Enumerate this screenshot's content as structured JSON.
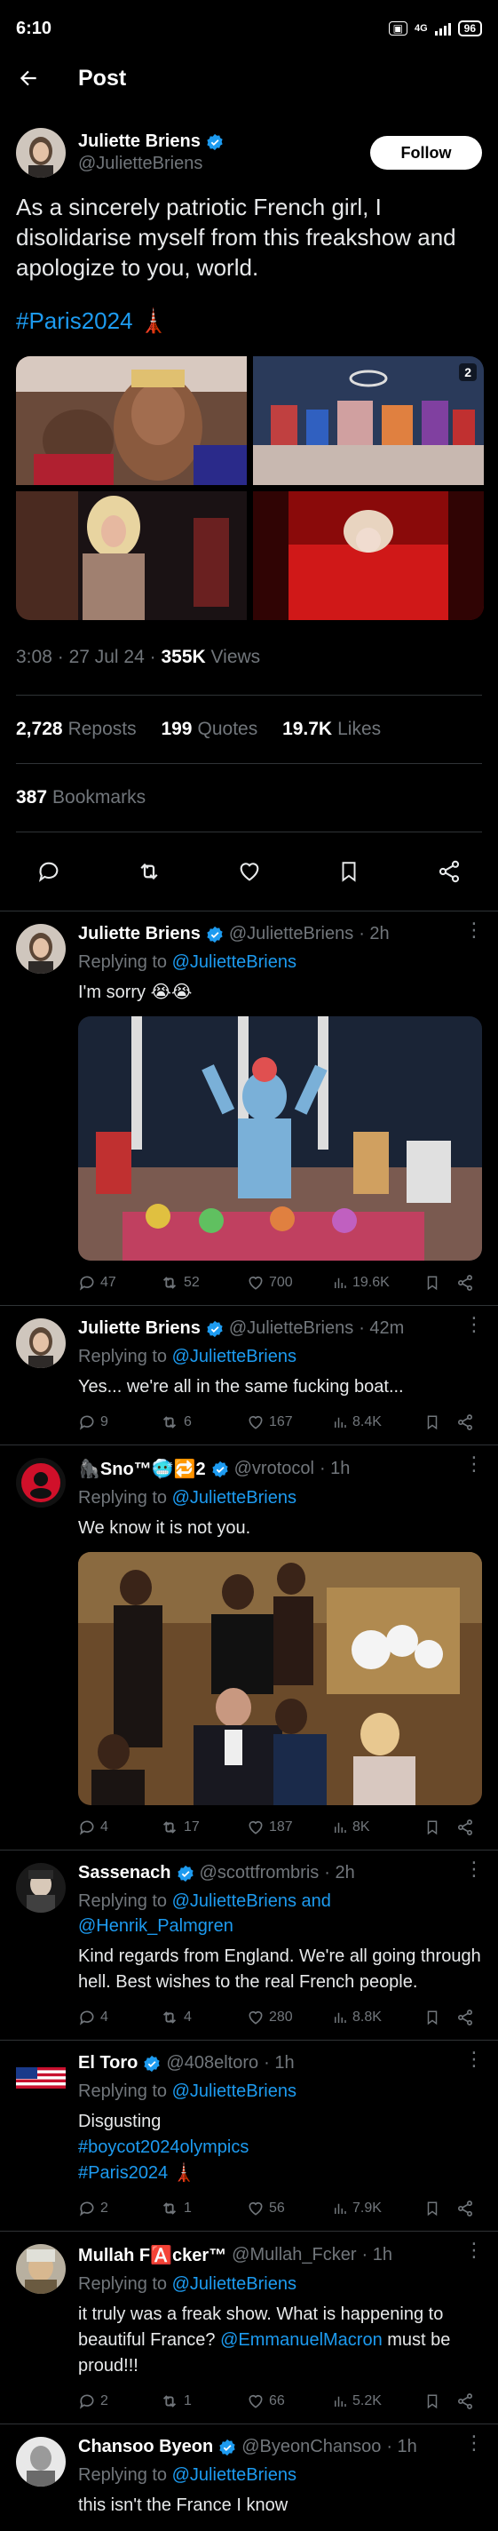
{
  "status_bar": {
    "time": "6:10",
    "volte": "4G",
    "battery": "96"
  },
  "header": {
    "title": "Post"
  },
  "tweet": {
    "author_name": "Juliette Briens",
    "author_handle": "@JulietteBriens",
    "follow_label": "Follow",
    "text": "As a sincerely patriotic French girl, I disolidarise myself from this freakshow and apologize to you, world.",
    "hashtag": "#Paris2024",
    "hashtag_emoji": "🗼",
    "media_badge": "2",
    "time": "3:08",
    "date": "27 Jul 24",
    "views": "355K",
    "views_label": "Views",
    "reposts": "2,728",
    "reposts_label": "Reposts",
    "quotes": "199",
    "quotes_label": "Quotes",
    "likes": "19.7K",
    "likes_label": "Likes",
    "bookmarks": "387",
    "bookmarks_label": "Bookmarks",
    "separator": "·"
  },
  "replies": [
    {
      "name": "Juliette Briens",
      "handle": "@JulietteBriens",
      "time": "· 2h",
      "replying_prefix": "Replying to ",
      "replying_to": "@JulietteBriens",
      "text": "I'm sorry 😭😭",
      "replies": "47",
      "reposts": "52",
      "likes": "700",
      "views": "19.6K"
    },
    {
      "name": "Juliette Briens",
      "handle": "@JulietteBriens",
      "time": "· 42m",
      "replying_prefix": "Replying to ",
      "replying_to": "@JulietteBriens",
      "text": "Yes... we're all in the same fucking boat...",
      "replies": "9",
      "reposts": "6",
      "likes": "167",
      "views": "8.4K"
    },
    {
      "name": "🦍Sno™🥶🔁2",
      "handle": "@vrotocol",
      "time": "· 1h",
      "replying_prefix": "Replying to ",
      "replying_to": "@JulietteBriens",
      "text": "We know it is not you.",
      "replies": "4",
      "reposts": "17",
      "likes": "187",
      "views": "8K"
    },
    {
      "name": "Sassenach",
      "handle": "@scottfrombris",
      "time": "· 2h",
      "replying_prefix": "Replying to ",
      "replying_to": "@JulietteBriens and @Henrik_Palmgren",
      "text": "Kind regards from England. We're all going through hell. Best wishes to the real French people.",
      "replies": "4",
      "reposts": "4",
      "likes": "280",
      "views": "8.8K"
    },
    {
      "name": "El Toro",
      "handle": "@408eltoro",
      "time": "· 1h",
      "replying_prefix": "Replying to ",
      "replying_to": "@JulietteBriens",
      "text_line1": "Disgusting",
      "text_line2": "#boycot2024olympics",
      "text_line3": "#Paris2024 🗼",
      "replies": "2",
      "reposts": "1",
      "likes": "56",
      "views": "7.9K"
    },
    {
      "name": "Mullah F🅰️cker™",
      "handle": "@Mullah_Fcker",
      "time": "· 1h",
      "replying_prefix": "Replying to ",
      "replying_to": "@JulietteBriens",
      "text": "it truly was a freak show. What is happening to beautiful France?",
      "mention": "@EmmanuelMacron",
      "text_after": " must be proud!!!",
      "replies": "2",
      "reposts": "1",
      "likes": "66",
      "views": "5.2K"
    },
    {
      "name": "Chansoo Byeon",
      "handle": "@ByeonChansoo",
      "time": "· 1h",
      "replying_prefix": "Replying to ",
      "replying_to": "@JulietteBriens",
      "text": "this isn't the France I know"
    }
  ],
  "icons": {
    "back": "arrow-left-icon",
    "verified": "verified-badge-icon",
    "reply": "speech-bubble-icon",
    "repost": "repost-arrows-icon",
    "like": "heart-icon",
    "bookmark": "bookmark-icon",
    "share": "share-icon",
    "views": "bar-chart-icon",
    "more": "more-dots-icon"
  },
  "colors": {
    "accent": "#1d9bf0",
    "background": "#000000",
    "muted": "#71767b",
    "divider": "#2f3336"
  }
}
